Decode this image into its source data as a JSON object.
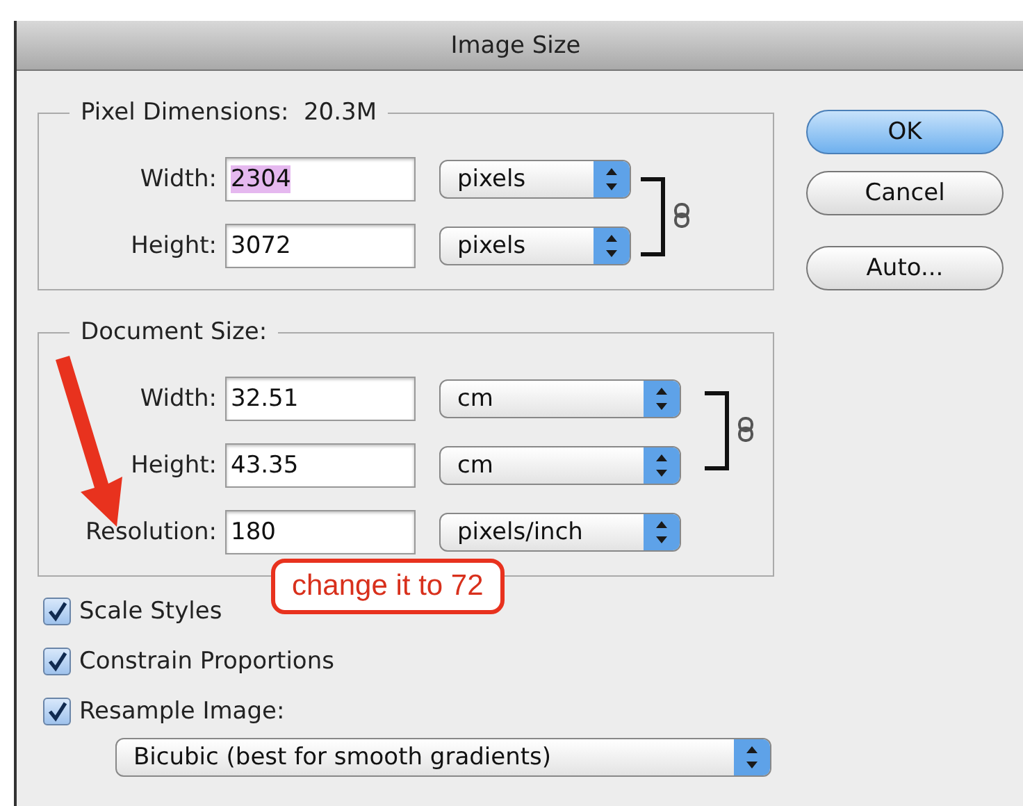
{
  "window": {
    "title": "Image Size"
  },
  "pixel_dimensions": {
    "label": "Pixel Dimensions:",
    "value": "20.3M",
    "linked": true,
    "fields": [
      {
        "label": "Width:",
        "value": "2304",
        "highlighted": true,
        "unit": "pixels"
      },
      {
        "label": "Height:",
        "value": "3072",
        "highlighted": false,
        "unit": "pixels"
      }
    ]
  },
  "document_size": {
    "label": "Document Size:",
    "linked": true,
    "fields": [
      {
        "label": "Width:",
        "value": "32.51",
        "highlighted": false,
        "unit": "cm"
      },
      {
        "label": "Height:",
        "value": "43.35",
        "highlighted": false,
        "unit": "cm"
      },
      {
        "label": "Resolution:",
        "value": "180",
        "highlighted": false,
        "unit": "pixels/inch"
      }
    ]
  },
  "options": [
    {
      "label": "Scale Styles",
      "checked": true
    },
    {
      "label": "Constrain Proportions",
      "checked": true
    },
    {
      "label": "Resample Image:",
      "checked": true
    }
  ],
  "resample_method": "Bicubic (best for smooth gradients)",
  "buttons": [
    {
      "label": "OK",
      "default": true
    },
    {
      "label": "Cancel",
      "default": false
    },
    {
      "label": "Auto...",
      "default": false
    }
  ],
  "annotation": {
    "text": "change it to 72"
  }
}
